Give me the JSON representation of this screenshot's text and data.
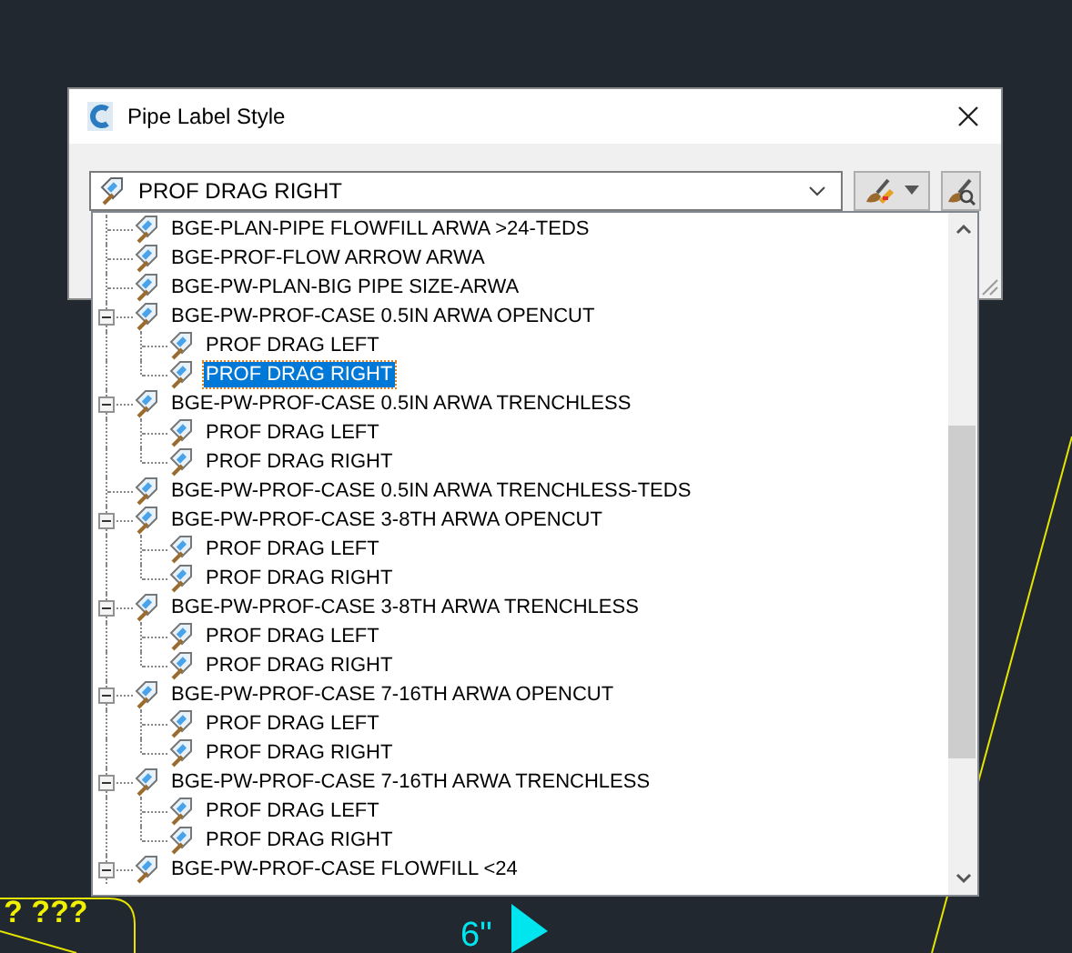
{
  "window": {
    "title": "Pipe Label Style"
  },
  "combo": {
    "value": "PROF DRAG RIGHT"
  },
  "tree": [
    {
      "label": "BGE-PLAN-PIPE FLOWFILL ARWA >24-TEDS",
      "selected": false
    },
    {
      "label": "BGE-PROF-FLOW ARROW ARWA",
      "selected": false
    },
    {
      "label": "BGE-PW-PLAN-BIG PIPE SIZE-ARWA",
      "selected": false
    },
    {
      "label": "BGE-PW-PROF-CASE 0.5IN ARWA OPENCUT",
      "selected": false,
      "expanded": true,
      "children": [
        {
          "label": "PROF DRAG LEFT",
          "selected": false
        },
        {
          "label": "PROF DRAG RIGHT",
          "selected": true
        }
      ]
    },
    {
      "label": "BGE-PW-PROF-CASE 0.5IN ARWA TRENCHLESS",
      "selected": false,
      "expanded": true,
      "children": [
        {
          "label": "PROF DRAG LEFT",
          "selected": false
        },
        {
          "label": "PROF DRAG RIGHT",
          "selected": false
        }
      ]
    },
    {
      "label": "BGE-PW-PROF-CASE 0.5IN ARWA TRENCHLESS-TEDS",
      "selected": false
    },
    {
      "label": "BGE-PW-PROF-CASE 3-8TH ARWA OPENCUT",
      "selected": false,
      "expanded": true,
      "children": [
        {
          "label": "PROF DRAG LEFT",
          "selected": false
        },
        {
          "label": "PROF DRAG RIGHT",
          "selected": false
        }
      ]
    },
    {
      "label": "BGE-PW-PROF-CASE 3-8TH ARWA TRENCHLESS",
      "selected": false,
      "expanded": true,
      "children": [
        {
          "label": "PROF DRAG LEFT",
          "selected": false
        },
        {
          "label": "PROF DRAG RIGHT",
          "selected": false
        }
      ]
    },
    {
      "label": "BGE-PW-PROF-CASE 7-16TH ARWA OPENCUT",
      "selected": false,
      "expanded": true,
      "children": [
        {
          "label": "PROF DRAG LEFT",
          "selected": false
        },
        {
          "label": "PROF DRAG RIGHT",
          "selected": false
        }
      ]
    },
    {
      "label": "BGE-PW-PROF-CASE 7-16TH ARWA TRENCHLESS",
      "selected": false,
      "expanded": true,
      "children": [
        {
          "label": "PROF DRAG LEFT",
          "selected": false
        },
        {
          "label": "PROF DRAG RIGHT",
          "selected": false
        }
      ]
    },
    {
      "label": "BGE-PW-PROF-CASE FLOWFILL <24",
      "selected": false,
      "expanded": true
    }
  ],
  "canvas": {
    "note": "? ???",
    "dimension": "6\""
  }
}
